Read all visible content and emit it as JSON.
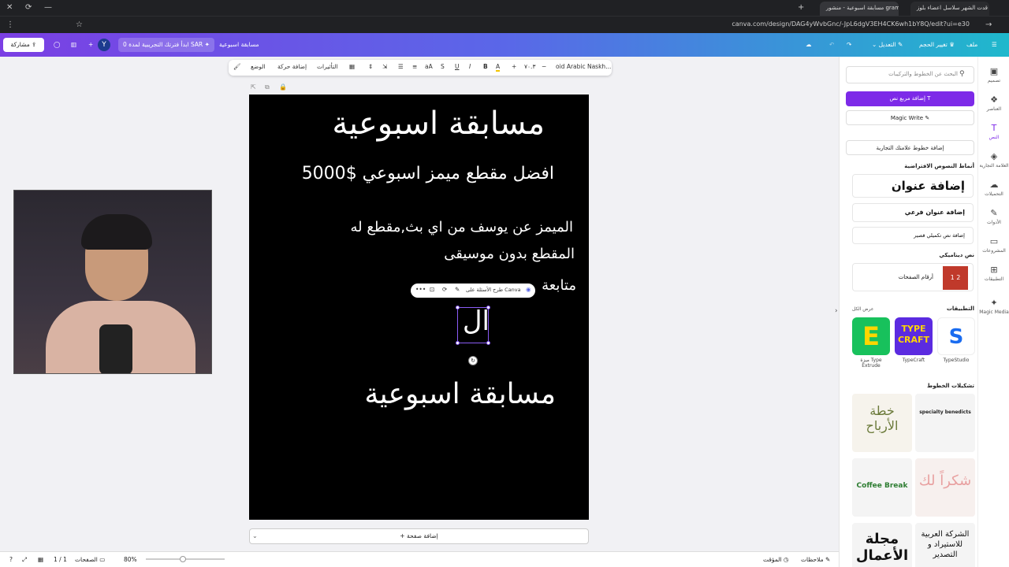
{
  "browser": {
    "tabs": [
      "مسابقة اسبوعية - منشور gram",
      "قدت الشهر سلاسل اعضاء بلوز !!"
    ],
    "url": "canva.com/design/DAG4yWvbGnc/-JpL6dgV3EH4CK6wh1bY8Q/edit?ui=e30"
  },
  "header": {
    "share_label": "مشاركة",
    "avatar_letter": "Y",
    "trial_label": "ابدأ فترتك التجريبية لمدة 0 SAR",
    "design_title": "مسابقة اسبوعية",
    "edit_label": "التعديل",
    "resize_label": "تغيير الحجم",
    "file_label": "ملف"
  },
  "toolbar": {
    "position_label": "الوضع",
    "animate_label": "إضافة حركة",
    "effects_label": "التأثيرات",
    "font_size": "٧٠.٣",
    "font_name": "Noto Naskh Arabic",
    "bold_label": "B",
    "color_label": "A",
    "font_name_display": "oid Arabic Naskh..."
  },
  "canvas": {
    "title": "مسابقة اسبوعية",
    "subtitle": "افضل مقطع ميمز اسبوعي $5000",
    "line1": "الميمز عن يوسف من اي بث,مقطع له",
    "line2": "المقطع بدون موسيقى",
    "line3": "متابعة",
    "editing_text": "ال",
    "footer_title": "مسابقة اسبوعية",
    "popup_label": "طرح الأسئلة على Canva"
  },
  "add_page_label": "+ إضافة صفحة",
  "bottombar": {
    "notes_label": "ملاحظات",
    "timer_label": "المؤقت",
    "zoom": "80%",
    "pages_label": "الصفحات",
    "page_count": "1 / 1"
  },
  "panel": {
    "search_placeholder": "البحث عن الخطوط والتركيبات",
    "add_text_box": "إضافة مربع نص",
    "magic_write": "Magic Write",
    "brand_fonts": "إضافة خطوط علامتك التجارية",
    "default_styles_title": "أنماط النصوص الافتراضية",
    "add_heading": "إضافة عنوان",
    "add_subheading": "إضافة عنوان فرعي",
    "add_body": "إضافة نص تكميلي قصير",
    "dynamic_text_title": "نص ديناميكي",
    "page_numbers": "أرقام الصفحات",
    "apps_title": "التطبيقات",
    "see_all": "عرض الكل",
    "apps": [
      {
        "name": "TypeStudio",
        "color": "#1a6cf0"
      },
      {
        "name": "TypeCraft",
        "color": "#5b2be0"
      },
      {
        "name": "ميزة Type Extrude",
        "color": "#18c15c"
      }
    ],
    "font_combos_title": "تشكيلات الخطوط",
    "combos": [
      "خطة الأرباح",
      "specialty benedicts",
      "Coffee Break",
      "شكراً لك",
      "مجلة الأعمال",
      "الشركة العربية للاستيراد و التصدير"
    ]
  },
  "rail": [
    "تصميم",
    "العناصر",
    "النص",
    "العلامة التجارية",
    "التحميلات",
    "الأدوات",
    "المشروعات",
    "التطبيقات",
    "Magic Media"
  ]
}
